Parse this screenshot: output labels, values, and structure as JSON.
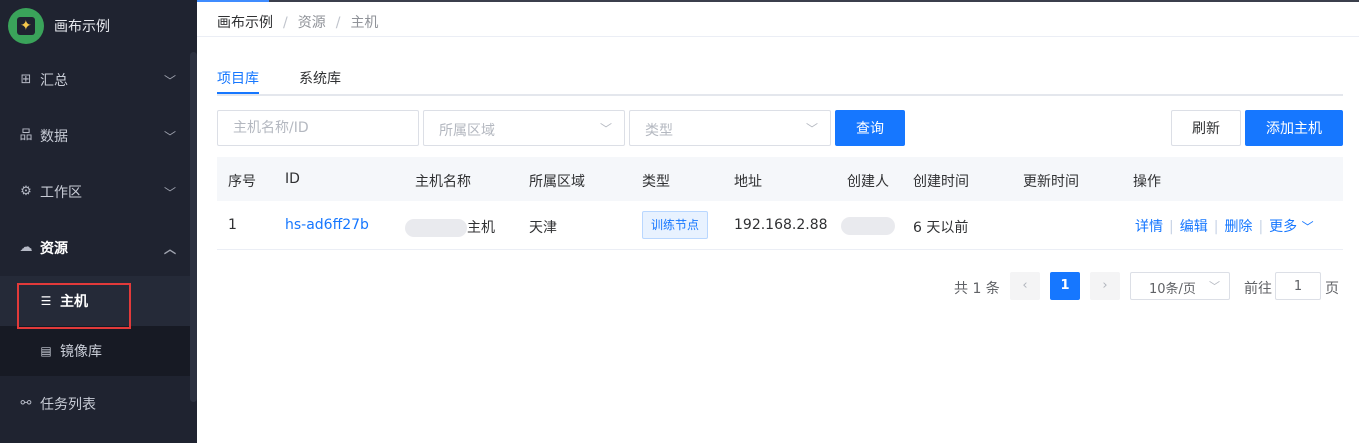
{
  "app": {
    "name": "画布示例"
  },
  "sidebar": {
    "items": [
      {
        "label": "汇总",
        "icon": "grid-icon"
      },
      {
        "label": "数据",
        "icon": "hierarchy-icon"
      },
      {
        "label": "工作区",
        "icon": "gear-icon"
      },
      {
        "label": "资源",
        "icon": "cloud-icon",
        "expanded": true
      },
      {
        "label": "任务列表",
        "icon": "nodes-icon"
      }
    ],
    "sub_items": [
      {
        "label": "主机",
        "icon": "server-icon",
        "active": true
      },
      {
        "label": "镜像库",
        "icon": "disk-icon"
      }
    ]
  },
  "breadcrumb": {
    "items": [
      "画布示例",
      "资源",
      "主机"
    ],
    "separator": "/"
  },
  "tabs": [
    {
      "label": "项目库",
      "active": true
    },
    {
      "label": "系统库"
    }
  ],
  "filters": {
    "host_placeholder": "主机名称/ID",
    "region_placeholder": "所属区域",
    "type_placeholder": "类型",
    "query_label": "查询"
  },
  "actions": {
    "refresh_label": "刷新",
    "add_host_label": "添加主机"
  },
  "table": {
    "columns": [
      "序号",
      "ID",
      "主机名称",
      "所属区域",
      "类型",
      "地址",
      "创建人",
      "创建时间",
      "更新时间",
      "操作"
    ],
    "rows": [
      {
        "index": "1",
        "id": "hs-ad6ff27b",
        "name_suffix": "主机",
        "region": "天津",
        "type": "训练节点",
        "address": "192.168.2.88",
        "created": "6 天以前",
        "updated": "",
        "ops": [
          "详情",
          "编辑",
          "删除",
          "更多"
        ]
      }
    ]
  },
  "pagination": {
    "total_text": "共 1 条",
    "current_page": "1",
    "page_size": "10条/页",
    "goto_label": "前往",
    "goto_value": "1",
    "page_unit": "页"
  },
  "colors": {
    "primary": "#1677ff",
    "sidebar_bg": "#1f2330",
    "highlight_box": "#e23a3a"
  }
}
